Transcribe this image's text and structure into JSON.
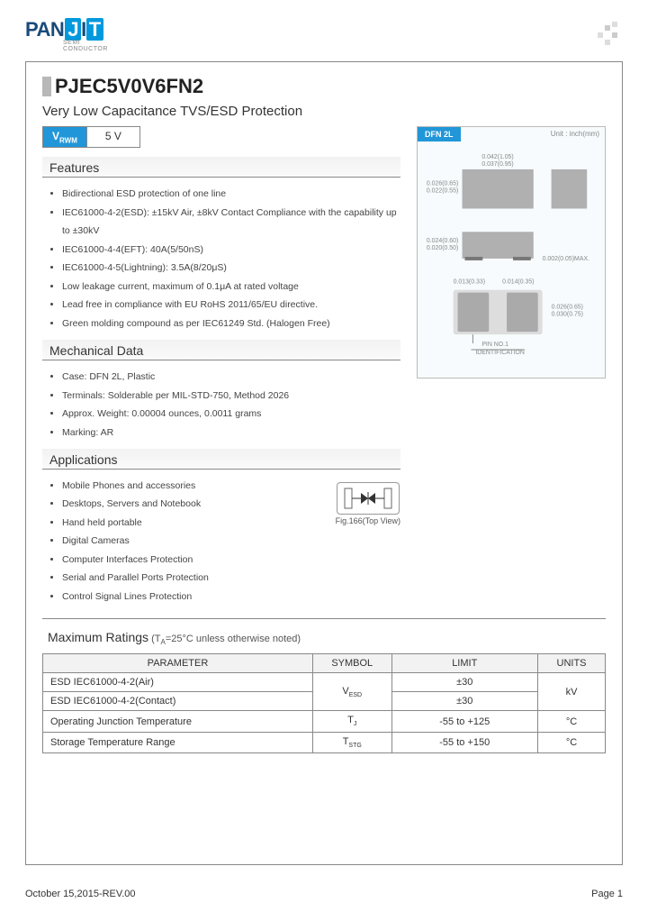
{
  "logo": {
    "pan": "PAN",
    "j": "J",
    "i": "I",
    "t": "T",
    "sub1": "SEMI",
    "sub2": "CONDUCTOR"
  },
  "part_number": "PJEC5V0V6FN2",
  "subtitle": "Very Low Capacitance TVS/ESD Protection",
  "vrwm": {
    "label": "V",
    "label_sub": "RWM",
    "value": "5 V"
  },
  "sections": {
    "features": "Features",
    "mechanical": "Mechanical Data",
    "applications": "Applications"
  },
  "features": [
    "Bidirectional ESD protection of one line",
    "IEC61000-4-2(ESD): ±15kV Air, ±8kV Contact Compliance with the capability up to ±30kV",
    "IEC61000-4-4(EFT): 40A(5/50nS)",
    "IEC61000-4-5(Lightning): 3.5A(8/20μS)",
    "Low leakage current, maximum of 0.1μA at rated voltage",
    "Lead free in compliance with EU RoHS 2011/65/EU directive.",
    "Green molding compound as per IEC61249 Std. (Halogen Free)"
  ],
  "mechanical": [
    "Case: DFN 2L, Plastic",
    "Terminals: Solderable per MIL-STD-750, Method 2026",
    "Approx. Weight: 0.00004 ounces, 0.0011 grams",
    "Marking: AR"
  ],
  "applications": [
    "Mobile Phones and accessories",
    "Desktops, Servers and Notebook",
    "Hand held portable",
    "Digital  Cameras",
    "Computer Interfaces Protection",
    "Serial and Parallel Ports Protection",
    "Control Signal Lines Protection"
  ],
  "fig_label": "Fig.166(Top View)",
  "package": {
    "name": "DFN 2L",
    "unit": "Unit : inch(mm)",
    "dim_w": "0.042(1.05)",
    "dim_w2": "0.037(0.95)",
    "dim_h": "0.026(0.65)",
    "dim_h2": "0.022(0.55)",
    "dim_t": "0.024(0.60)",
    "dim_t2": "0.020(0.50)",
    "dim_max": "0.002(0.05)MAX.",
    "dim_pad": "0.013(0.33)",
    "dim_gap": "0.014(0.35)",
    "dim_land_h": "0.026(0.65)",
    "dim_land_h2": "0.030(0.75)",
    "pin1": "PIN NO.1",
    "ident": "IDENTIFICATION"
  },
  "max_ratings": {
    "title": "Maximum Ratings",
    "cond_prefix": " (T",
    "cond_sub": "A",
    "cond_rest": "=25°C unless otherwise noted)",
    "headers": [
      "PARAMETER",
      "SYMBOL",
      "LIMIT",
      "UNITS"
    ],
    "rows": [
      {
        "param": "ESD IEC61000-4-2(Air)",
        "symbol": "",
        "limit": "±30",
        "units": ""
      },
      {
        "param": "ESD IEC61000-4-2(Contact)",
        "symbol": "V",
        "symbol_sub": "ESD",
        "limit": "±30",
        "units": "kV",
        "rowspan_sym": true
      },
      {
        "param": "Operating Junction Temperature",
        "symbol": "T",
        "symbol_sub": "J",
        "limit": "-55 to +125",
        "units": "°C"
      },
      {
        "param": "Storage Temperature Range",
        "symbol": "T",
        "symbol_sub": "STG",
        "limit": "-55 to +150",
        "units": "°C"
      }
    ]
  },
  "footer": {
    "left": "October 15,2015-REV.00",
    "right": "Page 1"
  }
}
